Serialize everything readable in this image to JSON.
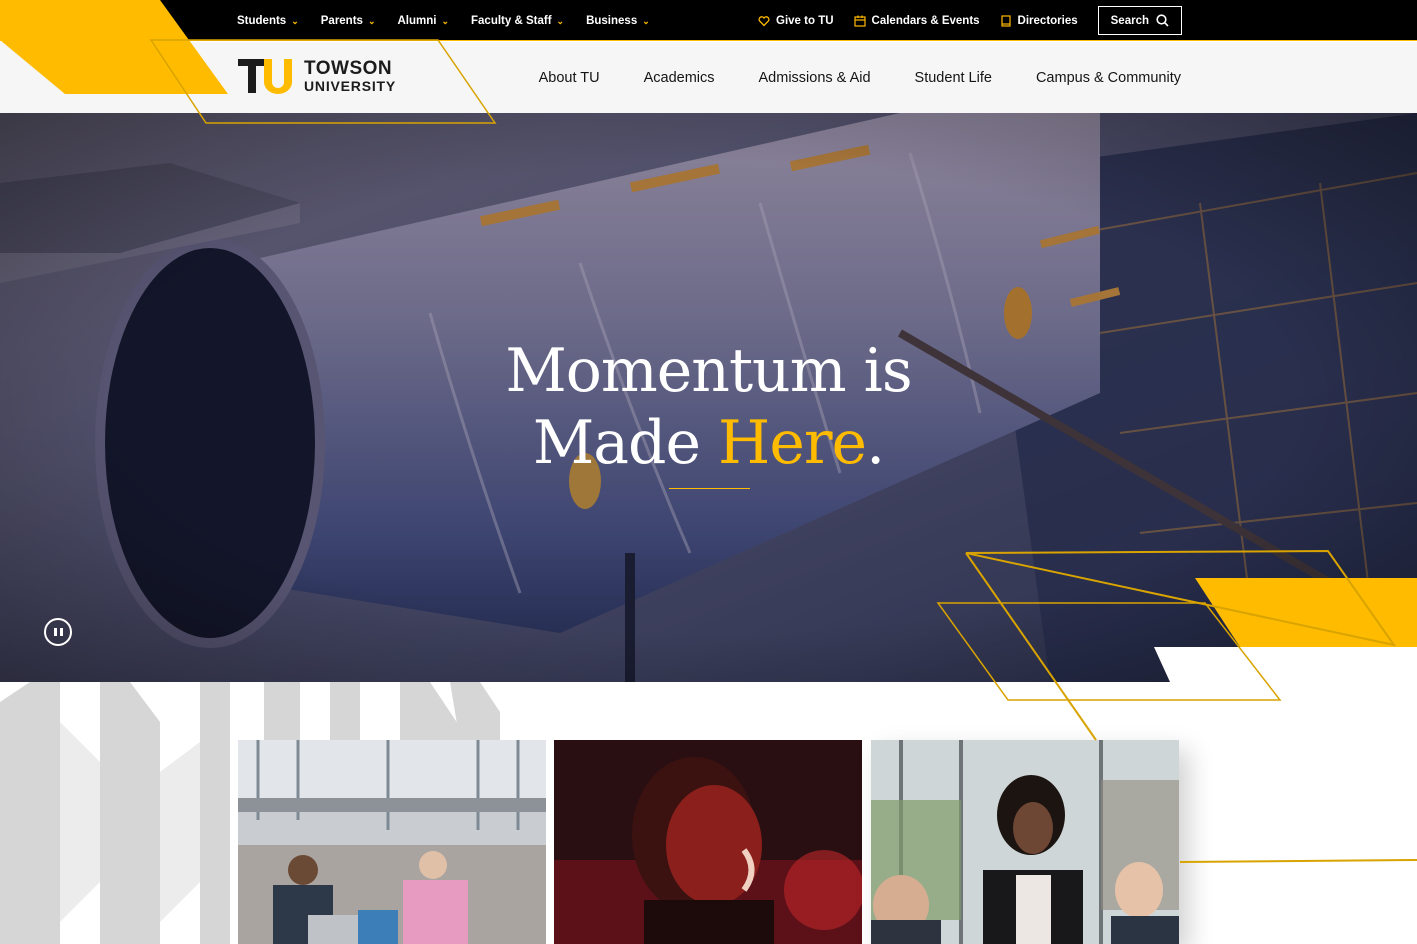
{
  "brand": {
    "logo_line1": "TOWSON",
    "logo_line2": "UNIVERSITY",
    "logo_mark": "TU",
    "colors": {
      "gold": "#ffbb00",
      "black": "#000000",
      "white": "#ffffff",
      "nav_bg": "#f6f6f6"
    }
  },
  "utility_nav": {
    "audiences": [
      {
        "label": "Students",
        "icon": "chevron-down-icon"
      },
      {
        "label": "Parents",
        "icon": "chevron-down-icon"
      },
      {
        "label": "Alumni",
        "icon": "chevron-down-icon"
      },
      {
        "label": "Faculty & Staff",
        "icon": "chevron-down-icon"
      },
      {
        "label": "Business",
        "icon": "chevron-down-icon"
      }
    ],
    "links": [
      {
        "label": "Give to TU",
        "icon": "heart-icon"
      },
      {
        "label": "Calendars & Events",
        "icon": "calendar-icon"
      },
      {
        "label": "Directories",
        "icon": "book-icon"
      }
    ],
    "search_label": "Search",
    "search_icon": "search-icon"
  },
  "main_nav": {
    "items": [
      {
        "label": "About TU"
      },
      {
        "label": "Academics"
      },
      {
        "label": "Admissions & Aid"
      },
      {
        "label": "Student Life"
      },
      {
        "label": "Campus & Community"
      }
    ]
  },
  "hero": {
    "headline_line1": "Momentum is",
    "headline_line2_plain": "Made ",
    "headline_line2_gold": "Here",
    "headline_period": ".",
    "pause_icon": "pause-icon"
  }
}
